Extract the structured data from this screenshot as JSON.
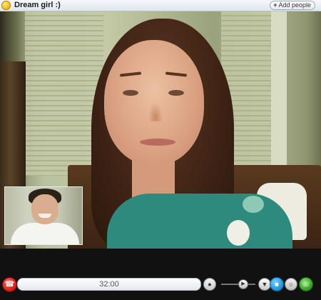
{
  "window": {
    "title": "Dream girl :)",
    "add_people_label": "Add people"
  },
  "call": {
    "duration": "32:00"
  },
  "controls": {
    "hangup_icon": "phone-hangup-icon",
    "mic_icon": "microphone-icon",
    "volume_icon": "volume-icon",
    "dropdown_icon": "chevron-down-icon",
    "video_icon": "video-camera-icon",
    "chat_icon": "chat-bubble-icon",
    "call_icon": "phone-call-icon"
  },
  "colors": {
    "hangup": "#d11b10",
    "video_toggle": "#1a8ed6",
    "call": "#2e9d1c"
  }
}
